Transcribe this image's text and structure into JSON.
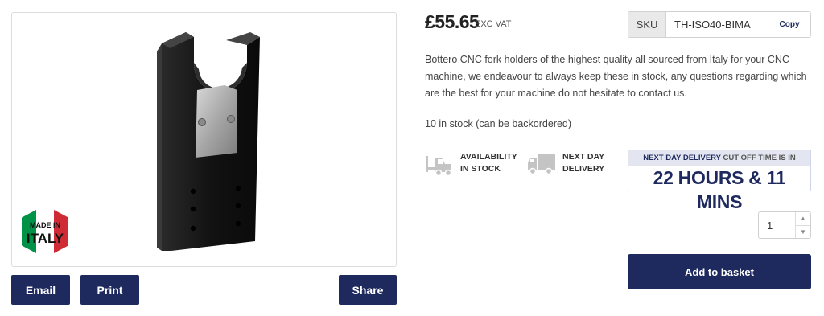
{
  "product": {
    "price": "£55.65",
    "price_suffix": "EXC VAT",
    "sku": {
      "label": "SKU",
      "value": "TH-ISO40-BIMA",
      "copy_label": "Copy"
    },
    "description": "Bottero CNC fork holders of the highest quality all sourced from Italy for your CNC machine, we endeavour to always keep these in stock, any questions regarding which are the best for your machine do not hesitate to contact us.",
    "stock_text": "10 in stock (can be backordered)"
  },
  "badge": {
    "line1": "MADE IN",
    "line2": "ITALY",
    "colors": [
      "#009246",
      "#ffffff",
      "#ce2b37"
    ]
  },
  "image_actions": {
    "email": "Email",
    "print": "Print",
    "share": "Share"
  },
  "features": [
    {
      "icon": "forklift-icon",
      "line1": "AVAILABILITY",
      "line2": "IN STOCK"
    },
    {
      "icon": "truck-icon",
      "line1": "NEXT DAY",
      "line2": "DELIVERY"
    }
  ],
  "delivery_cutoff": {
    "highlight": "NEXT DAY DELIVERY",
    "rest": "CUT OFF TIME IS IN",
    "countdown": "22 HOURS & 11 MINS"
  },
  "quantity": {
    "value": "1"
  },
  "add_to_basket": "Add to basket",
  "colors": {
    "accent": "#1e2a5e",
    "product_body": "#141414"
  }
}
